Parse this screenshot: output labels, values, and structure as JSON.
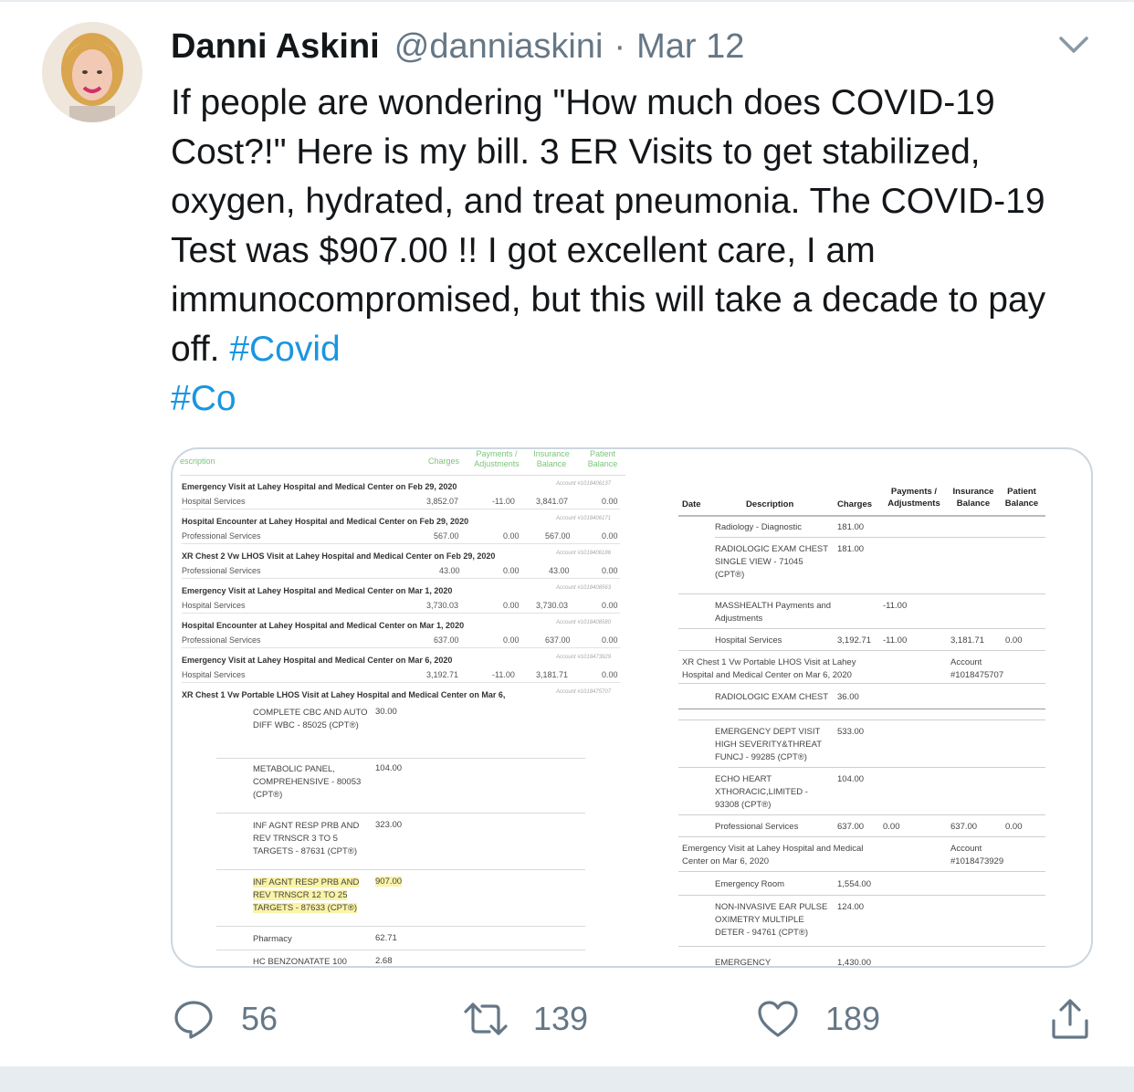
{
  "tweet": {
    "author_name": "Danni Askini",
    "handle": "@danniaskini",
    "separator": "·",
    "date": "Mar 12",
    "text_main": "If people are wondering \"How much does COVID-19 Cost?!\" Here is my bill. 3 ER Visits to get stabilized, oxygen, hydrated, and treat pneumonia. The COVID-19 Test was $907.00 !! I got excellent care, I am immunocompromised, but this will take a decade to pay off. ",
    "hashtag1": "#Covid",
    "hashtag2": "#Co"
  },
  "actions": {
    "replies": "56",
    "retweets": "139",
    "likes": "189"
  },
  "bill_left": {
    "header": {
      "description": "escription",
      "charges": "Charges",
      "payments": "Payments / Adjustments",
      "insurance": "Insurance Balance",
      "patient": "Patient Balance"
    },
    "encounters": [
      {
        "title": "Emergency Visit at Lahey Hospital and Medical Center on Feb 29, 2020",
        "account": "Account #1018406137",
        "service": "Hospital Services",
        "charges": "3,852.07",
        "payments": "-11.00",
        "insurance": "3,841.07",
        "patient": "0.00"
      },
      {
        "title": "Hospital Encounter at Lahey Hospital and Medical Center on Feb 29, 2020",
        "account": "Account #1018406171",
        "service": "Professional Services",
        "charges": "567.00",
        "payments": "0.00",
        "insurance": "567.00",
        "patient": "0.00"
      },
      {
        "title": "XR Chest 2 Vw LHOS Visit at Lahey Hospital and Medical Center on Feb 29, 2020",
        "account": "Account #1018406186",
        "service": "Professional Services",
        "charges": "43.00",
        "payments": "0.00",
        "insurance": "43.00",
        "patient": "0.00"
      },
      {
        "title": "Emergency Visit at Lahey Hospital and Medical Center on Mar 1, 2020",
        "account": "Account #1018408563",
        "service": "Hospital Services",
        "charges": "3,730.03",
        "payments": "0.00",
        "insurance": "3,730.03",
        "patient": "0.00"
      },
      {
        "title": "Hospital Encounter at Lahey Hospital and Medical Center on Mar 1, 2020",
        "account": "Account #1018408580",
        "service": "Professional Services",
        "charges": "637.00",
        "payments": "0.00",
        "insurance": "637.00",
        "patient": "0.00"
      },
      {
        "title": "Emergency Visit at Lahey Hospital and Medical Center on Mar 6, 2020",
        "account": "Account #1018473929",
        "service": "Hospital Services",
        "charges": "3,192.71",
        "payments": "-11.00",
        "insurance": "3,181.71",
        "patient": "0.00"
      },
      {
        "title": "XR Chest 1 Vw Portable LHOS Visit at Lahey Hospital and Medical Center on Mar 6,",
        "account": "Account #1018475707",
        "service": "",
        "charges": "",
        "payments": "",
        "insurance": "",
        "patient": ""
      }
    ],
    "line_items": [
      {
        "desc": "COMPLETE CBC AND AUTO DIFF WBC - 85025 (CPT®)",
        "amount": "30.00"
      },
      {
        "desc": "METABOLIC PANEL, COMPREHENSIVE - 80053 (CPT®)",
        "amount": "104.00"
      },
      {
        "desc": "INF AGNT RESP PRB AND REV TRNSCR 3 TO 5 TARGETS - 87631 (CPT®)",
        "amount": "323.00"
      },
      {
        "desc": "INF AGNT RESP PRB AND REV TRNSCR 12 TO 25 TARGETS - 87633 (CPT®)",
        "amount": "907.00"
      },
      {
        "desc": "Pharmacy",
        "amount": "62.71"
      },
      {
        "desc": "HC BENZONATATE 100",
        "amount": "2.68"
      }
    ]
  },
  "bill_right": {
    "header": {
      "date": "Date",
      "description": "Description",
      "charges": "Charges",
      "payments": "Payments / Adjustments",
      "insurance": "Insurance Balance",
      "patient": "Patient Balance"
    },
    "rows": {
      "radiology": "Radiology - Diagnostic",
      "radiology_amt": "181.00",
      "xray_desc": "RADIOLOGIC EXAM CHEST SINGLE VIEW - 71045 (CPT®)",
      "xray_amt": "181.00",
      "masshealth": "MASSHEALTH Payments and Adjustments",
      "masshealth_amt": "-11.00",
      "hosp_services": "Hospital Services",
      "hosp_charges": "3,192.71",
      "hosp_payments": "-11.00",
      "hosp_insurance": "3,181.71",
      "hosp_patient": "0.00",
      "enc_xr": "XR Chest 1 Vw Portable LHOS Visit at Lahey Hospital and Medical Center on Mar 6, 2020",
      "enc_xr_account": "Account #1018475707",
      "radiologic_exam": "RADIOLOGIC EXAM CHEST",
      "radiologic_exam_amt": "36.00",
      "ed_visit": "EMERGENCY DEPT VISIT HIGH SEVERITY&THREAT FUNCJ - 99285 (CPT®)",
      "ed_visit_amt": "533.00",
      "echo": "ECHO HEART XTHORACIC,LIMITED - 93308 (CPT®)",
      "echo_amt": "104.00",
      "prof_services": "Professional Services",
      "prof_charges": "637.00",
      "prof_payments": "0.00",
      "prof_insurance": "637.00",
      "prof_patient": "0.00",
      "enc_er": "Emergency Visit at Lahey Hospital and Medical Center on Mar 6, 2020",
      "enc_er_account": "Account #1018473929",
      "er_room": "Emergency Room",
      "er_room_amt": "1,554.00",
      "oximetry": "NON-INVASIVE EAR PULSE OXIMETRY MULTIPLE DETER - 94761 (CPT®)",
      "oximetry_amt": "124.00",
      "emergency": "EMERGENCY",
      "emergency_amt": "1,430.00"
    }
  },
  "icons": {
    "chevron": "chevron-down-icon",
    "reply": "reply-icon",
    "retweet": "retweet-icon",
    "like": "heart-icon",
    "share": "share-icon"
  },
  "colors": {
    "link": "#1b95e0",
    "secondary_text": "#657786",
    "primary_text": "#14171a",
    "highlight": "#fbf3a6"
  }
}
